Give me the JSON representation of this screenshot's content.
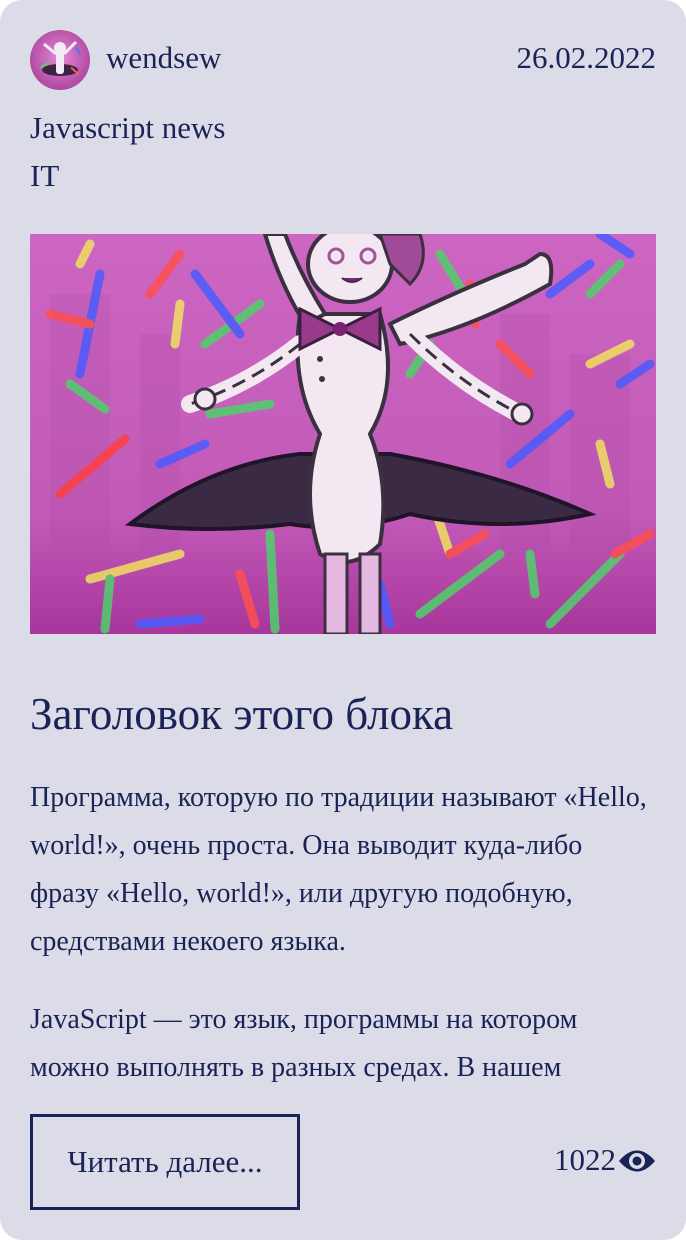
{
  "post": {
    "author": "wendsew",
    "date": "26.02.2022",
    "categories": [
      "Javascript news",
      "IT"
    ],
    "title": "Заголовок этого блока",
    "paragraphs": [
      "Программа, которую по традиции называют «Hello, world!», очень проста. Она выводит куда-либо фразу «Hello, world!», или другую подобную, средствами некоего языка.",
      "JavaScript — это язык, программы на котором можно выполнять в разных средах. В нашем"
    ],
    "read_more_label": "Читать далее...",
    "views": "1022"
  },
  "icons": {
    "avatar": "user-avatar",
    "views": "eye-icon"
  },
  "colors": {
    "card_bg": "#dcdce8",
    "text": "#1a2356"
  }
}
